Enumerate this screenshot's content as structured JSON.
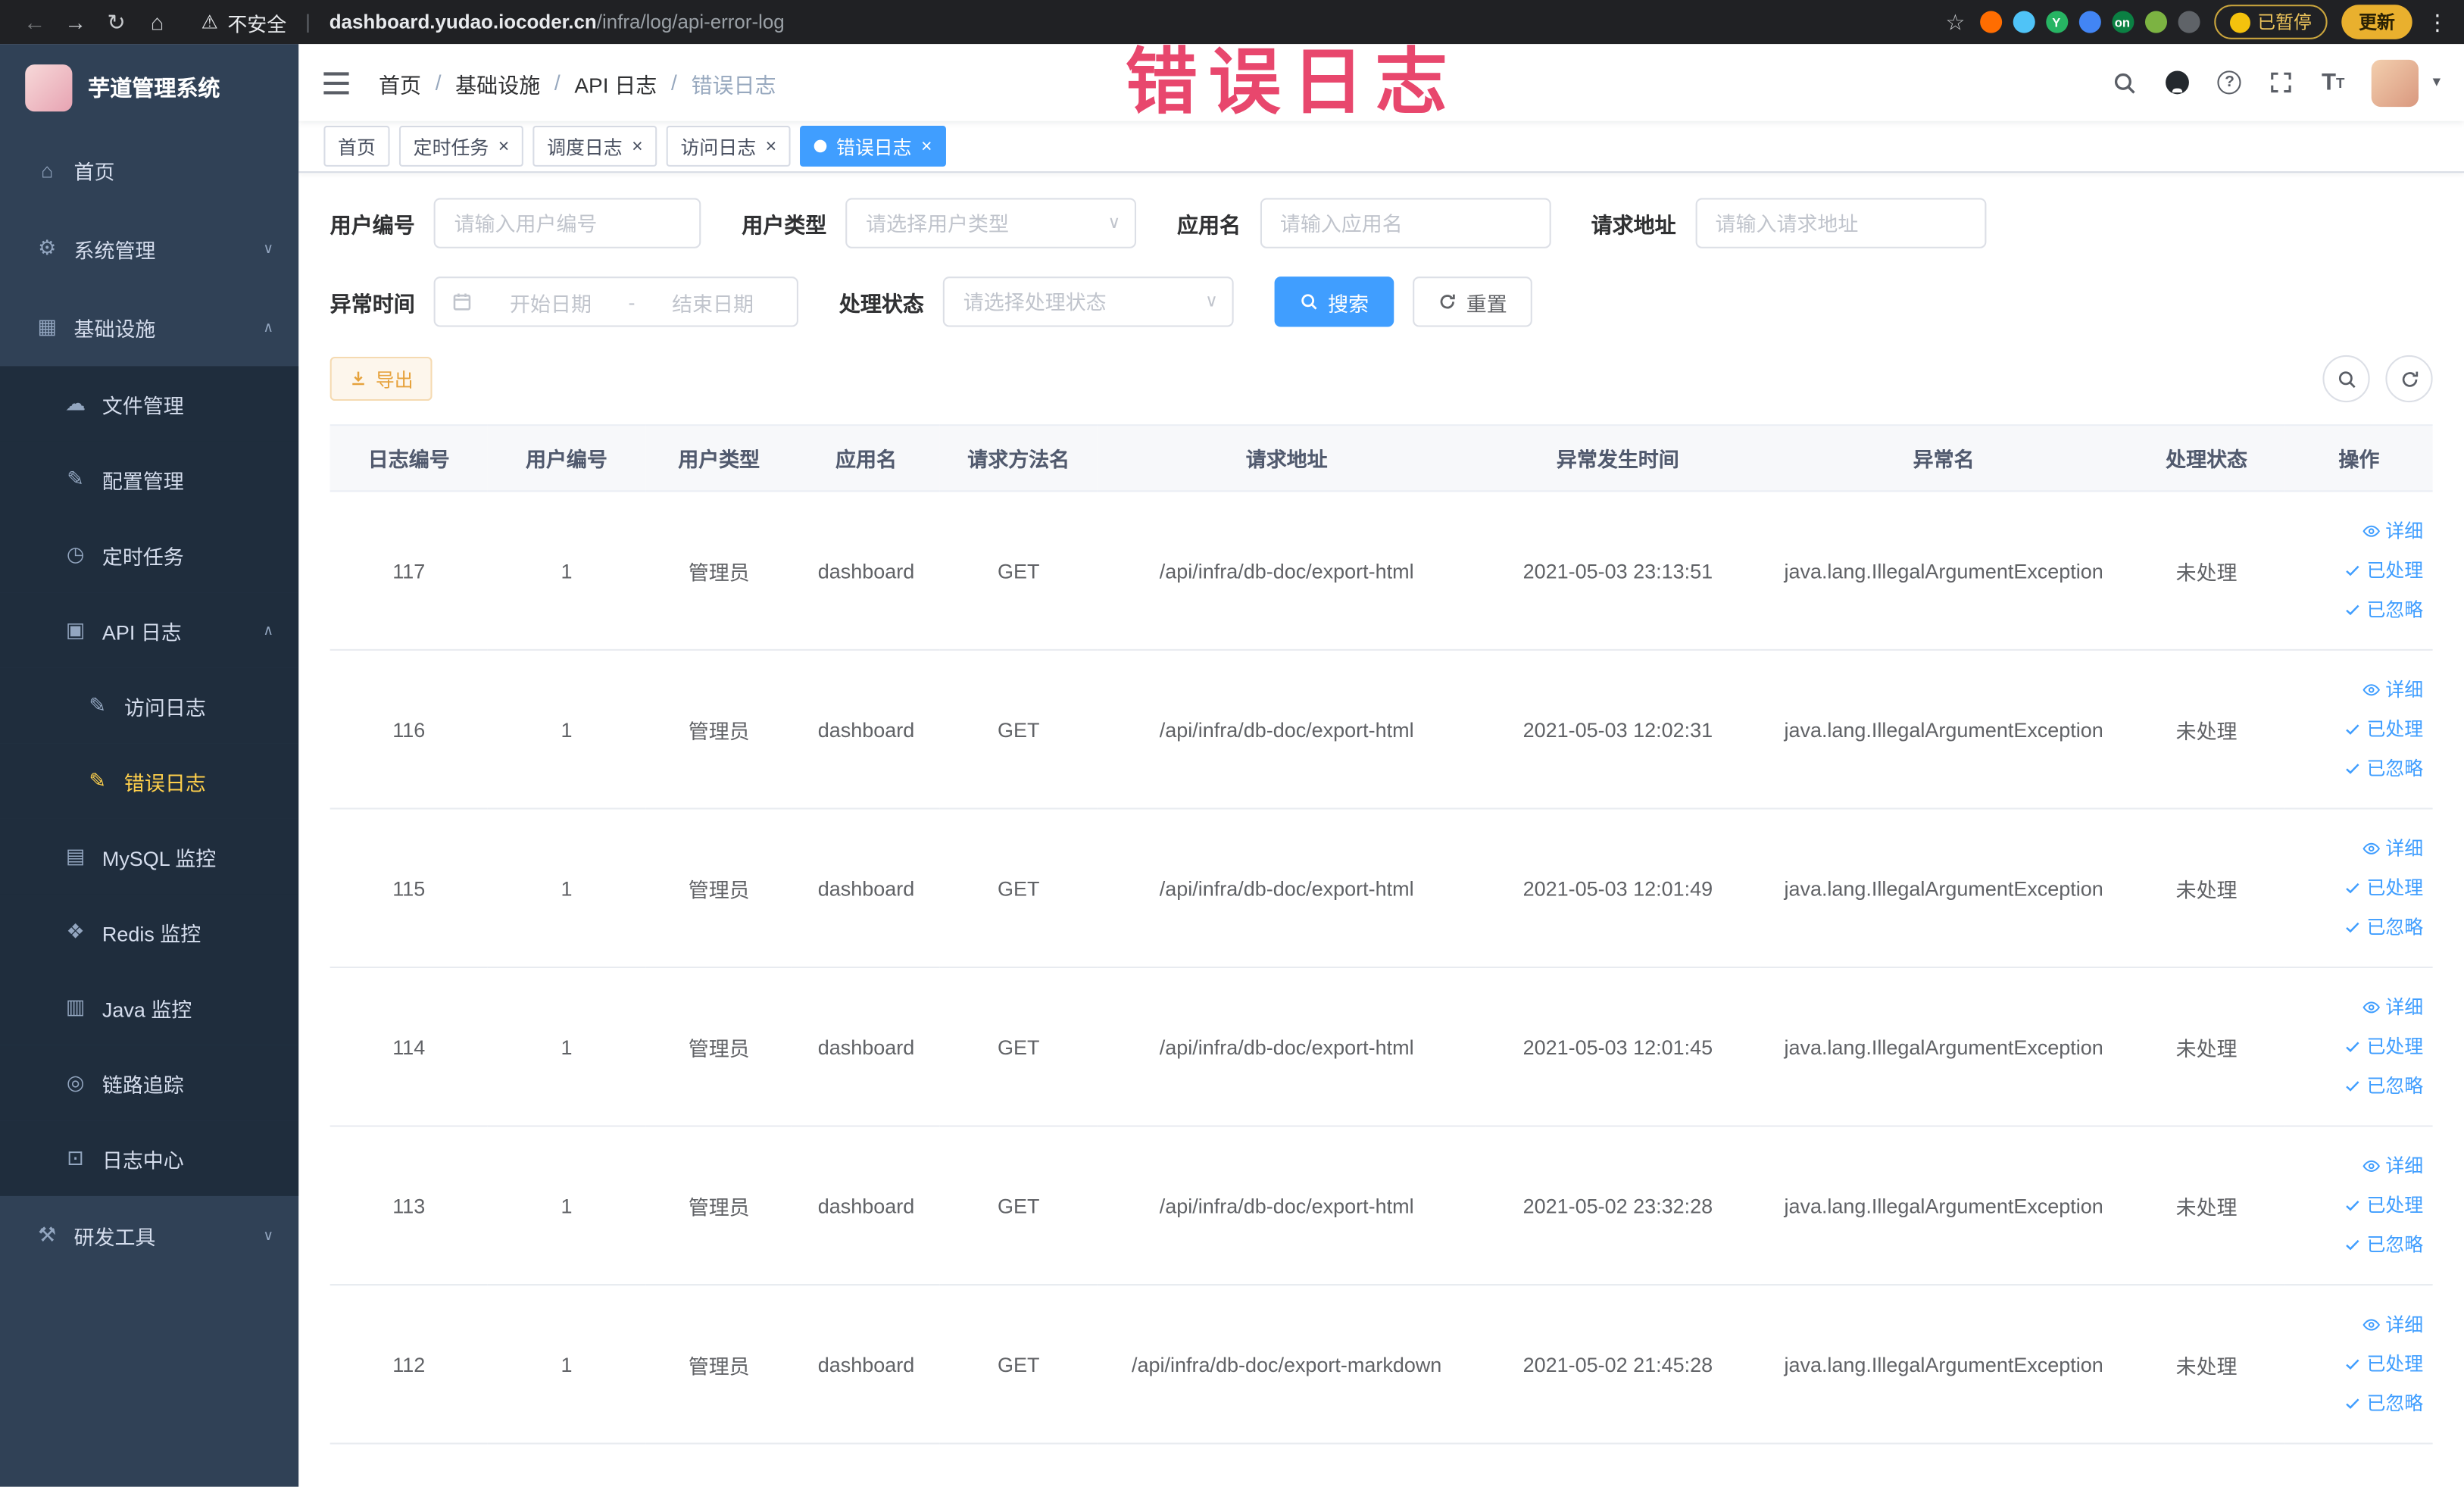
{
  "colors": {
    "primary": "#409eff",
    "active_menu": "#ffd04b",
    "warning": "#e6a23c",
    "sidebar_bg": "#304156",
    "submenu_bg": "#1f2d3d",
    "watermark": "#e8476d"
  },
  "watermark": {
    "text": "错误日志"
  },
  "browser": {
    "nav_icons": [
      {
        "name": "back-icon",
        "glyph": "←",
        "dim": true
      },
      {
        "name": "forward-icon",
        "glyph": "→"
      },
      {
        "name": "reload-icon",
        "glyph": "↻"
      },
      {
        "name": "home-icon",
        "glyph": "⌂"
      }
    ],
    "warning_icon": "⚠",
    "security_label": "不安全",
    "divider": "|",
    "url_domain": "dashboard.yudao.iocoder.cn",
    "url_path": "/infra/log/api-error-log",
    "star_icon": "☆",
    "extensions": [
      {
        "color": "#ff6d01"
      },
      {
        "color": "#4fc3f7"
      },
      {
        "color": "#27b463",
        "label": "Y"
      },
      {
        "color": "#4285f4"
      },
      {
        "color": "#0b8043",
        "label": "on"
      },
      {
        "color": "#7cb342"
      },
      {
        "color": "#5f6368"
      }
    ],
    "paused_label": "已暂停",
    "update_label": "更新",
    "menu_icon": "⋮"
  },
  "sidebar": {
    "logo_title": "芋道管理系统",
    "items": [
      {
        "id": "home",
        "label": "首页",
        "glyph": "⌂",
        "icon": "home-icon",
        "level": 1
      },
      {
        "id": "system",
        "label": "系统管理",
        "glyph": "⚙",
        "icon": "gear-icon",
        "level": 1,
        "chevron": "down"
      },
      {
        "id": "infra",
        "label": "基础设施",
        "glyph": "▦",
        "icon": "grid-icon",
        "level": 1,
        "chevron": "up"
      },
      {
        "id": "file",
        "label": "文件管理",
        "glyph": "☁",
        "icon": "cloud-icon",
        "level": 2,
        "dark": true
      },
      {
        "id": "config",
        "label": "配置管理",
        "glyph": "✎",
        "icon": "edit-icon",
        "level": 2,
        "dark": true
      },
      {
        "id": "job",
        "label": "定时任务",
        "glyph": "◷",
        "icon": "clock-icon",
        "level": 2,
        "dark": true
      },
      {
        "id": "api-log",
        "label": "API 日志",
        "glyph": "▣",
        "icon": "document-icon",
        "level": 2,
        "dark": true,
        "chevron": "up"
      },
      {
        "id": "access-log",
        "label": "访问日志",
        "glyph": "✎",
        "icon": "log-edit-icon",
        "level": 3,
        "dark": true
      },
      {
        "id": "error-log",
        "label": "错误日志",
        "glyph": "✎",
        "icon": "log-edit-icon",
        "level": 3,
        "dark": true,
        "active": true
      },
      {
        "id": "mysql",
        "label": "MySQL 监控",
        "glyph": "▤",
        "icon": "database-icon",
        "level": 2,
        "dark": true
      },
      {
        "id": "redis",
        "label": "Redis 监控",
        "glyph": "❖",
        "icon": "redis-icon",
        "level": 2,
        "dark": true
      },
      {
        "id": "java",
        "label": "Java 监控",
        "glyph": "▥",
        "icon": "java-icon",
        "level": 2,
        "dark": true
      },
      {
        "id": "trace",
        "label": "链路追踪",
        "glyph": "◎",
        "icon": "trace-icon",
        "level": 2,
        "dark": true
      },
      {
        "id": "log-center",
        "label": "日志中心",
        "glyph": "⊡",
        "icon": "log-center-icon",
        "level": 2,
        "dark": true
      },
      {
        "id": "dev-tools",
        "label": "研发工具",
        "glyph": "⚒",
        "icon": "tools-icon",
        "level": 1,
        "chevron": "down"
      }
    ]
  },
  "header": {
    "breadcrumb": [
      "首页",
      "基础设施",
      "API 日志",
      "错误日志"
    ],
    "separator": "/",
    "help_glyph": "?",
    "fontsize_large": "T",
    "fontsize_small": "T",
    "caret": "▾"
  },
  "tags_meta": {
    "close_glyph": "×"
  },
  "tags": [
    {
      "label": "首页",
      "closable": false,
      "active": false
    },
    {
      "label": "定时任务",
      "closable": true,
      "active": false
    },
    {
      "label": "调度日志",
      "closable": true,
      "active": false
    },
    {
      "label": "访问日志",
      "closable": true,
      "active": false
    },
    {
      "label": "错误日志",
      "closable": true,
      "active": true
    }
  ],
  "filters": {
    "user_id": {
      "label": "用户编号",
      "placeholder": "请输入用户编号"
    },
    "user_type": {
      "label": "用户类型",
      "placeholder": "请选择用户类型"
    },
    "app_name": {
      "label": "应用名",
      "placeholder": "请输入应用名"
    },
    "request_url": {
      "label": "请求地址",
      "placeholder": "请输入请求地址"
    },
    "exception_time": {
      "label": "异常时间",
      "start_placeholder": "开始日期",
      "separator": "-",
      "end_placeholder": "结束日期"
    },
    "process_status": {
      "label": "处理状态",
      "placeholder": "请选择处理状态"
    },
    "search_label": "搜索",
    "reset_label": "重置"
  },
  "toolbar": {
    "export_label": "导出"
  },
  "table": {
    "columns": [
      "日志编号",
      "用户编号",
      "用户类型",
      "应用名",
      "请求方法名",
      "请求地址",
      "异常发生时间",
      "异常名",
      "处理状态",
      "操作"
    ],
    "action_labels": {
      "detail": "详细",
      "processed": "已处理",
      "ignored": "已忽略"
    },
    "rows": [
      {
        "id": "117",
        "user_id": "1",
        "user_type": "管理员",
        "app": "dashboard",
        "method": "GET",
        "url": "/api/infra/db-doc/export-html",
        "time": "2021-05-03 23:13:51",
        "exception": "java.lang.IllegalArgumentException",
        "status": "未处理"
      },
      {
        "id": "116",
        "user_id": "1",
        "user_type": "管理员",
        "app": "dashboard",
        "method": "GET",
        "url": "/api/infra/db-doc/export-html",
        "time": "2021-05-03 12:02:31",
        "exception": "java.lang.IllegalArgumentException",
        "status": "未处理"
      },
      {
        "id": "115",
        "user_id": "1",
        "user_type": "管理员",
        "app": "dashboard",
        "method": "GET",
        "url": "/api/infra/db-doc/export-html",
        "time": "2021-05-03 12:01:49",
        "exception": "java.lang.IllegalArgumentException",
        "status": "未处理"
      },
      {
        "id": "114",
        "user_id": "1",
        "user_type": "管理员",
        "app": "dashboard",
        "method": "GET",
        "url": "/api/infra/db-doc/export-html",
        "time": "2021-05-03 12:01:45",
        "exception": "java.lang.IllegalArgumentException",
        "status": "未处理"
      },
      {
        "id": "113",
        "user_id": "1",
        "user_type": "管理员",
        "app": "dashboard",
        "method": "GET",
        "url": "/api/infra/db-doc/export-html",
        "time": "2021-05-02 23:32:28",
        "exception": "java.lang.IllegalArgumentException",
        "status": "未处理"
      },
      {
        "id": "112",
        "user_id": "1",
        "user_type": "管理员",
        "app": "dashboard",
        "method": "GET",
        "url": "/api/infra/db-doc/export-markdown",
        "time": "2021-05-02 21:45:28",
        "exception": "java.lang.IllegalArgumentException",
        "status": "未处理"
      }
    ]
  }
}
